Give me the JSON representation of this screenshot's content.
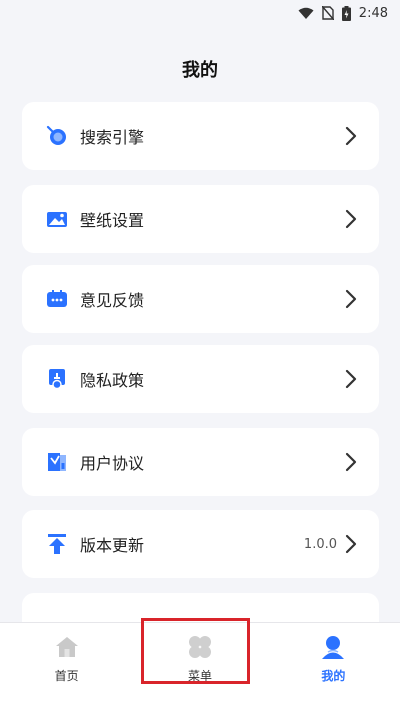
{
  "status_bar": {
    "time": "2:48"
  },
  "page": {
    "title": "我的"
  },
  "menu": {
    "items": [
      {
        "label": "搜索引擎",
        "icon": "search-engine-icon"
      },
      {
        "label": "壁纸设置",
        "icon": "wallpaper-icon"
      },
      {
        "label": "意见反馈",
        "icon": "feedback-icon"
      },
      {
        "label": "隐私政策",
        "icon": "privacy-icon"
      },
      {
        "label": "用户协议",
        "icon": "agreement-icon"
      },
      {
        "label": "版本更新",
        "icon": "update-icon",
        "value": "1.0.0"
      }
    ]
  },
  "nav": {
    "items": [
      {
        "label": "首页",
        "icon": "home-icon",
        "active": false
      },
      {
        "label": "菜单",
        "icon": "menu-grid-icon",
        "active": false
      },
      {
        "label": "我的",
        "icon": "profile-icon",
        "active": true
      }
    ]
  },
  "colors": {
    "accent": "#2b72ff",
    "highlight": "#d9242a",
    "background": "#f4f5f9"
  }
}
